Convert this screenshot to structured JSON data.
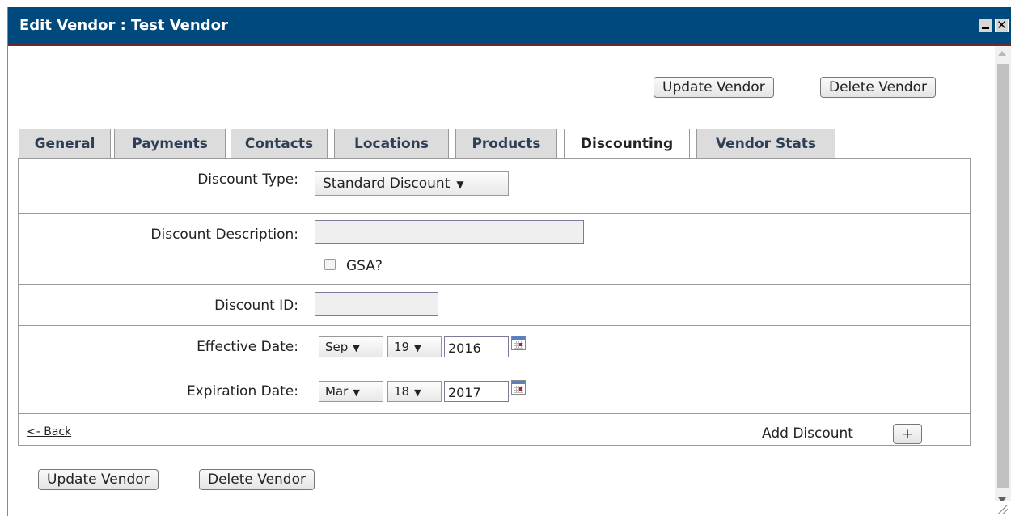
{
  "window": {
    "title": "Edit Vendor : Test Vendor",
    "close_glyph": "✕"
  },
  "toolbar": {
    "update_label": "Update Vendor",
    "delete_label": "Delete Vendor"
  },
  "tabs": [
    {
      "label": "General"
    },
    {
      "label": "Payments"
    },
    {
      "label": "Contacts"
    },
    {
      "label": "Locations"
    },
    {
      "label": "Products"
    },
    {
      "label": "Discounting",
      "active": true
    },
    {
      "label": "Vendor Stats"
    }
  ],
  "form": {
    "discount_type": {
      "label": "Discount Type:",
      "value": "Standard Discount"
    },
    "discount_description": {
      "label": "Discount Description:",
      "value": ""
    },
    "gsa": {
      "label": "GSA?",
      "checked": false
    },
    "discount_id": {
      "label": "Discount ID:",
      "value": ""
    },
    "effective_date": {
      "label": "Effective Date:",
      "month": "Sep",
      "day": "19",
      "year": "2016"
    },
    "expiration_date": {
      "label": "Expiration Date:",
      "month": "Mar",
      "day": "18",
      "year": "2017"
    }
  },
  "footer": {
    "back_label": "<- Back",
    "add_discount_label": "Add Discount",
    "add_glyph": "+"
  },
  "icons": {
    "dropdown": "▼"
  }
}
